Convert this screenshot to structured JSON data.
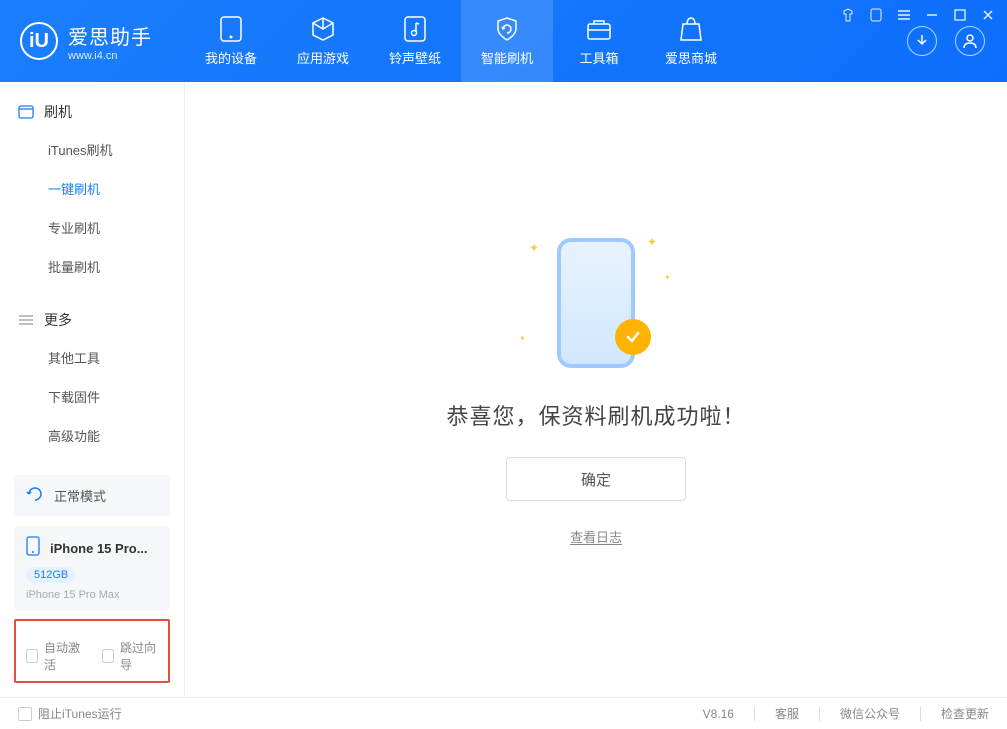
{
  "logo": {
    "title": "爱思助手",
    "subtitle": "www.i4.cn",
    "mark": "iU"
  },
  "nav": [
    {
      "label": "我的设备"
    },
    {
      "label": "应用游戏"
    },
    {
      "label": "铃声壁纸"
    },
    {
      "label": "智能刷机"
    },
    {
      "label": "工具箱"
    },
    {
      "label": "爱思商城"
    }
  ],
  "sidebar": {
    "section1": {
      "title": "刷机",
      "items": [
        "iTunes刷机",
        "一键刷机",
        "专业刷机",
        "批量刷机"
      ]
    },
    "section2": {
      "title": "更多",
      "items": [
        "其他工具",
        "下载固件",
        "高级功能"
      ]
    }
  },
  "mode": {
    "label": "正常模式"
  },
  "device": {
    "name": "iPhone 15 Pro...",
    "storage": "512GB",
    "model": "iPhone 15 Pro Max"
  },
  "checks": {
    "autoActivate": "自动激活",
    "skipGuide": "跳过向导"
  },
  "main": {
    "successText": "恭喜您，保资料刷机成功啦！",
    "okBtn": "确定",
    "logLink": "查看日志"
  },
  "footer": {
    "blockItunes": "阻止iTunes运行",
    "version": "V8.16",
    "links": [
      "客服",
      "微信公众号",
      "检查更新"
    ]
  }
}
